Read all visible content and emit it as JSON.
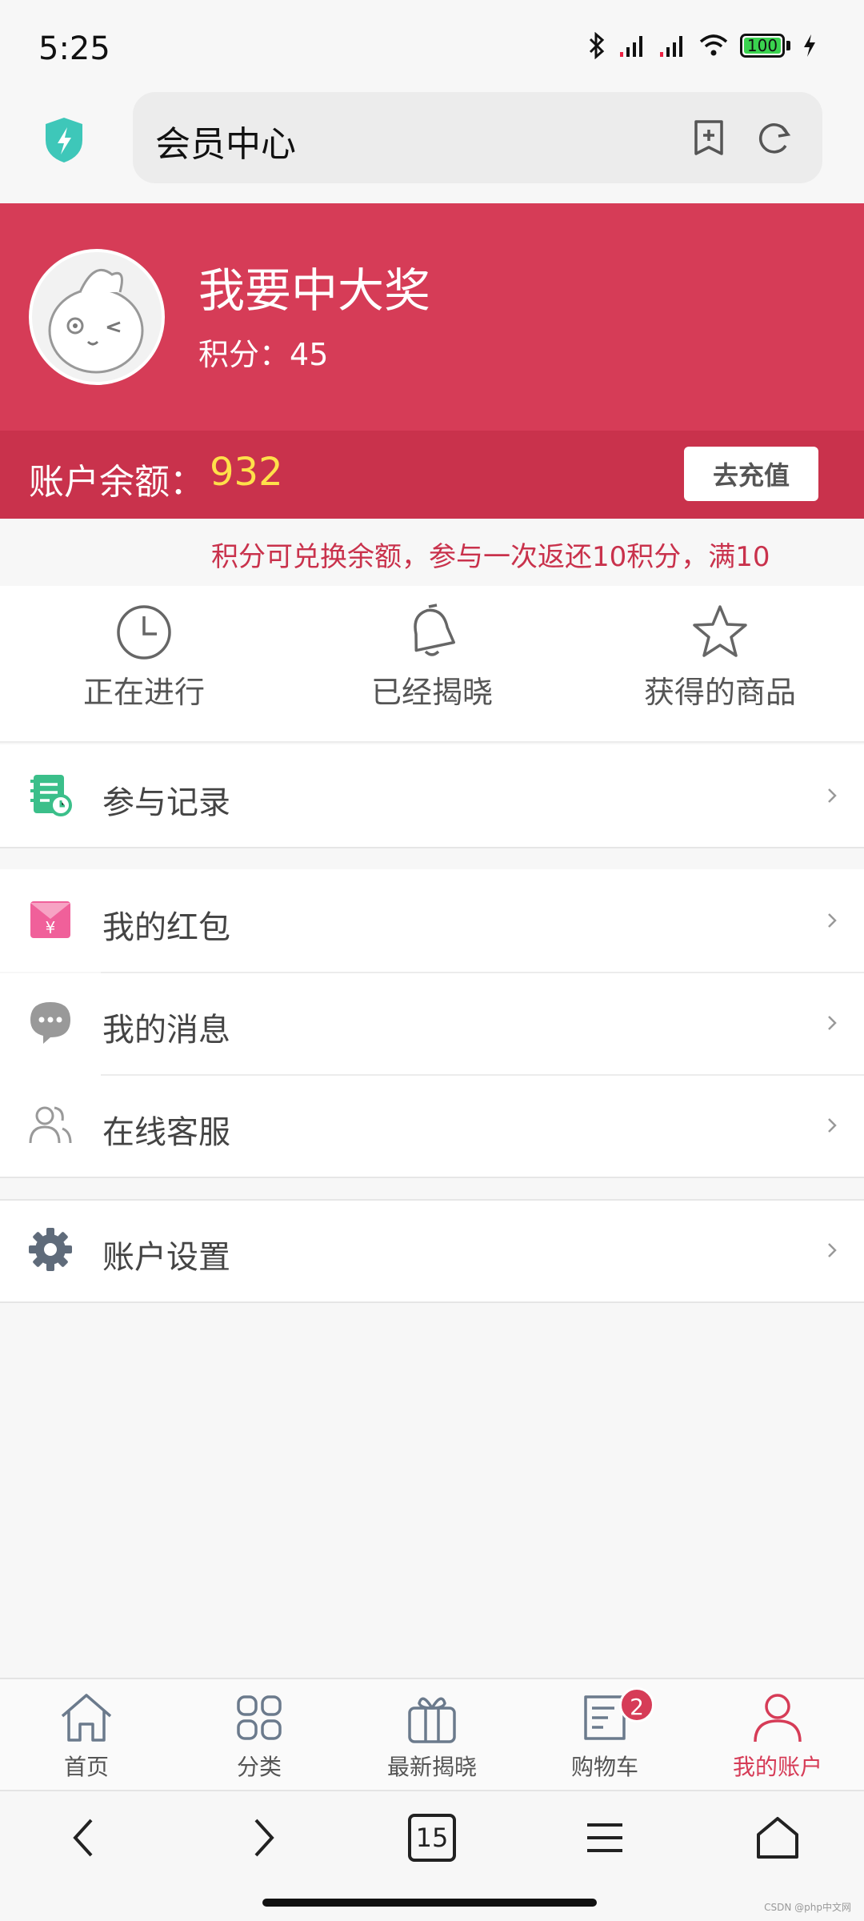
{
  "status_bar": {
    "time": "5:25",
    "battery": "100"
  },
  "browser": {
    "url_text": "会员中心",
    "tab_count": "15"
  },
  "header": {
    "user_name": "我要中大奖",
    "points_label": "积分：",
    "points_value": "45",
    "balance_label": "账户余额：",
    "balance_value": "932",
    "recharge_label": "去充值"
  },
  "notice": {
    "text": "积分可兑换余额，参与一次返还10积分，满10"
  },
  "quick_actions": [
    {
      "label": "正在进行",
      "icon": "clock-icon"
    },
    {
      "label": "已经揭晓",
      "icon": "bell-icon"
    },
    {
      "label": "获得的商品",
      "icon": "star-icon"
    }
  ],
  "menu": {
    "records": "参与记录",
    "red_packets": "我的红包",
    "messages": "我的消息",
    "support": "在线客服",
    "settings": "账户设置"
  },
  "tabs": [
    {
      "label": "首页",
      "icon": "home-icon"
    },
    {
      "label": "分类",
      "icon": "category-icon"
    },
    {
      "label": "最新揭晓",
      "icon": "gift-icon"
    },
    {
      "label": "购物车",
      "icon": "cart-icon"
    },
    {
      "label": "我的账户",
      "icon": "user-icon"
    }
  ],
  "cart_badge": "2",
  "watermark": "CSDN @php中文网",
  "colors": {
    "brand": "#d63c57",
    "brand_dark": "#c9324c",
    "balance": "#ffe04a",
    "records_green": "#3bbf8a",
    "red_packet_pink": "#f0609a"
  }
}
